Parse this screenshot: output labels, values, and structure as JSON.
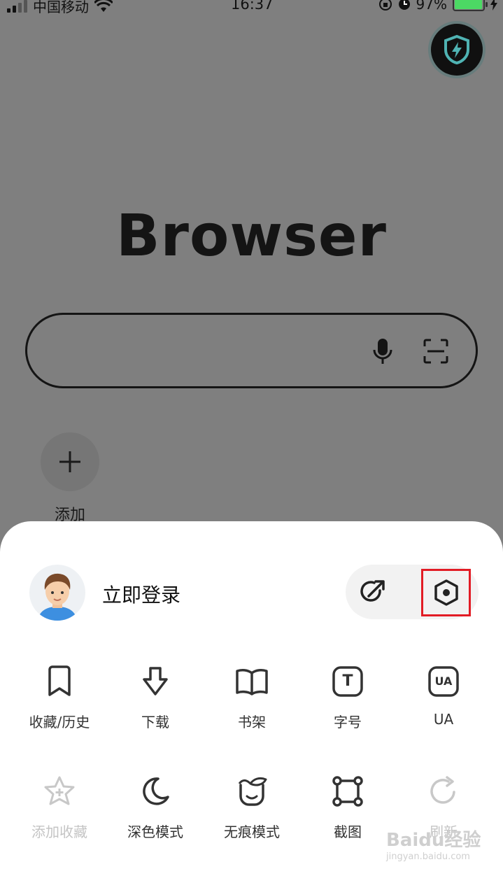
{
  "status_bar": {
    "carrier": "中国移动",
    "time": "16:37",
    "battery": "97%",
    "battery_level": 0.97
  },
  "logo": {
    "text": "Browser"
  },
  "search": {
    "placeholder": ""
  },
  "shortcuts": {
    "add_label": "添加"
  },
  "sheet": {
    "login_label": "立即登录",
    "row1": [
      {
        "label": "收藏/历史",
        "icon": "bookmark-icon"
      },
      {
        "label": "下载",
        "icon": "download-icon"
      },
      {
        "label": "书架",
        "icon": "book-icon"
      },
      {
        "label": "字号",
        "icon": "font-size-icon"
      },
      {
        "label": "UA",
        "icon": "ua-icon"
      }
    ],
    "row2": [
      {
        "label": "添加收藏",
        "icon": "star-add-icon"
      },
      {
        "label": "深色模式",
        "icon": "moon-icon"
      },
      {
        "label": "无痕模式",
        "icon": "incognito-icon"
      },
      {
        "label": "截图",
        "icon": "screenshot-icon"
      },
      {
        "label": "刷新",
        "icon": "refresh-icon"
      }
    ],
    "ua_icon_text": "UA",
    "font_icon_text": "T"
  },
  "watermark": {
    "main": "Baidu经验",
    "sub": "jingyan.baidu.com"
  },
  "colors": {
    "highlight": "#e21c25",
    "battery": "#4cd964",
    "overlay": "#7f7f7f"
  }
}
